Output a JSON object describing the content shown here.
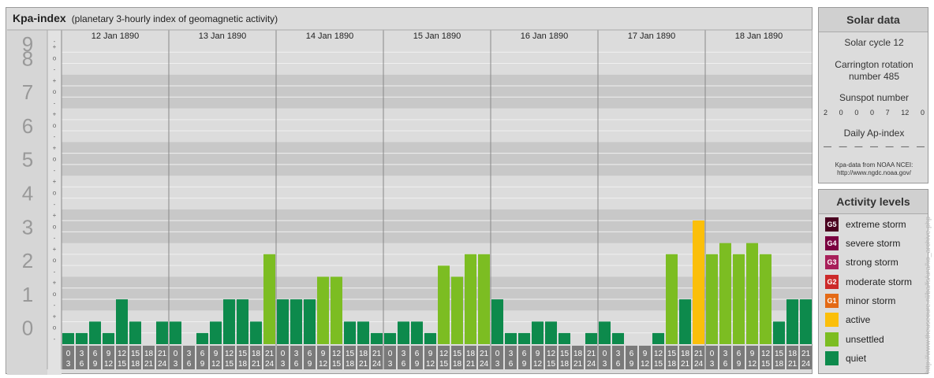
{
  "header": {
    "title": "Kpa-index",
    "subtitle": "(planetary 3-hourly index of geomagnetic activity)"
  },
  "solar": {
    "title": "Solar data",
    "cycle": "Solar cycle 12",
    "carrington_line1": "Carrington rotation",
    "carrington_line2": "number 485",
    "sunspot_label": "Sunspot number",
    "sunspot_values": [
      "2",
      "0",
      "0",
      "0",
      "7",
      "12",
      "0"
    ],
    "ap_label": "Daily Ap-index",
    "ap_values": [
      "—",
      "—",
      "—",
      "—",
      "—",
      "—",
      "—"
    ],
    "credit_line1": "Kpa-data from NOAA NCEI:",
    "credit_line2": "http://www.ngdc.noaa.gov/"
  },
  "levels": {
    "title": "Activity levels",
    "items": [
      {
        "code": "G5",
        "label": "extreme storm",
        "color": "#4a0020"
      },
      {
        "code": "G4",
        "label": "severe storm",
        "color": "#7a0040"
      },
      {
        "code": "G3",
        "label": "strong storm",
        "color": "#a8205a"
      },
      {
        "code": "G2",
        "label": "moderate storm",
        "color": "#cc2a2a"
      },
      {
        "code": "G1",
        "label": "minor storm",
        "color": "#e46a16"
      },
      {
        "code": "",
        "label": "active",
        "color": "#fbbf0a"
      },
      {
        "code": "",
        "label": "unsettled",
        "color": "#7cbd22"
      },
      {
        "code": "",
        "label": "quiet",
        "color": "#0d8a4c"
      }
    ]
  },
  "watermark": "http://www.theusecure.nl/ba/fs/ura/ko_archive.php",
  "chart_data": {
    "type": "bar",
    "title": "Kpa-index",
    "subtitle": "(planetary 3-hourly index of geomagnetic activity)",
    "ylim": [
      0,
      9
    ],
    "yticks": [
      "0",
      "1",
      "2",
      "3",
      "4",
      "5",
      "6",
      "7",
      "8",
      "9"
    ],
    "ysubticks": [
      "-",
      "o",
      "+"
    ],
    "days": [
      "12 Jan 1890",
      "13 Jan 1890",
      "14 Jan 1890",
      "15 Jan 1890",
      "16 Jan 1890",
      "17 Jan 1890",
      "18 Jan 1890"
    ],
    "hour_start": [
      "0",
      "3",
      "6",
      "9",
      "12",
      "15",
      "18",
      "21"
    ],
    "hour_end": [
      "3",
      "6",
      "9",
      "12",
      "15",
      "18",
      "21",
      "24"
    ],
    "values": [
      [
        0.33,
        0.33,
        0.67,
        0.33,
        1.33,
        0.67,
        0.0,
        0.67
      ],
      [
        0.67,
        0.0,
        0.33,
        0.67,
        1.33,
        1.33,
        0.67,
        2.67
      ],
      [
        1.33,
        1.33,
        1.33,
        2.0,
        2.0,
        0.67,
        0.67,
        0.33
      ],
      [
        0.33,
        0.67,
        0.67,
        0.33,
        2.33,
        2.0,
        2.67,
        2.67
      ],
      [
        1.33,
        0.33,
        0.33,
        0.67,
        0.67,
        0.33,
        0.0,
        0.33
      ],
      [
        0.67,
        0.33,
        0.0,
        0.0,
        0.33,
        2.67,
        1.33,
        3.67
      ],
      [
        2.67,
        3.0,
        2.67,
        3.0,
        2.67,
        0.67,
        1.33,
        1.33
      ]
    ],
    "colors": {
      "quiet": "#0d8a4c",
      "unsettled": "#7cbd22",
      "active": "#fbbf0a"
    }
  }
}
